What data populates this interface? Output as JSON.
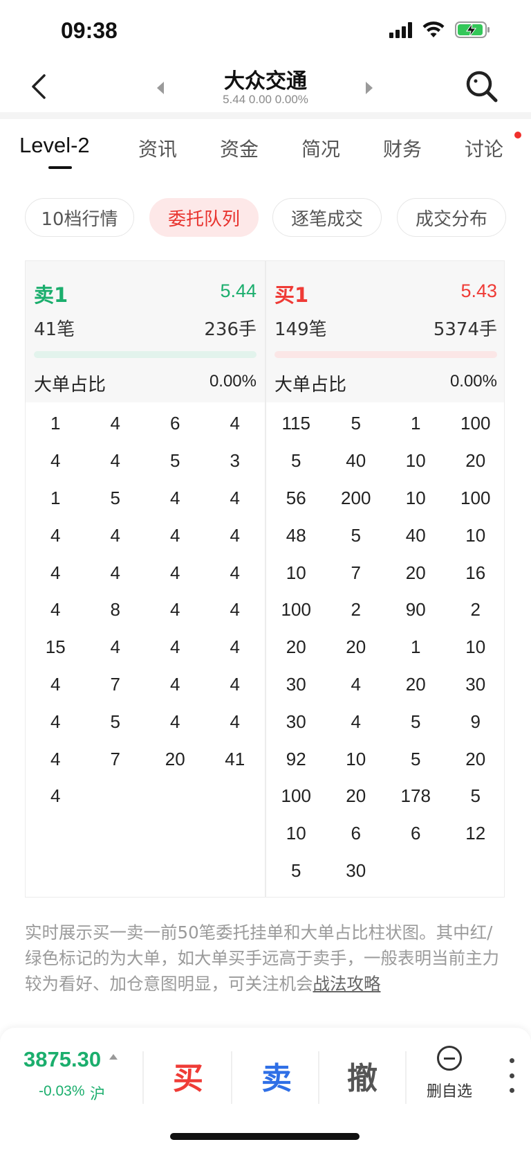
{
  "status_bar": {
    "time": "09:38"
  },
  "header": {
    "stock_name": "大众交通",
    "stock_quote": "5.44 0.00 0.00%"
  },
  "tabs": [
    {
      "label": "Level-2",
      "active": true
    },
    {
      "label": "资讯"
    },
    {
      "label": "资金"
    },
    {
      "label": "简况"
    },
    {
      "label": "财务"
    },
    {
      "label": "讨论"
    }
  ],
  "subtabs": [
    {
      "label": "10档行情"
    },
    {
      "label": "委托队列",
      "active": true
    },
    {
      "label": "逐笔成交"
    },
    {
      "label": "成交分布"
    }
  ],
  "sell": {
    "label": "卖1",
    "price": "5.44",
    "orders": "41笔",
    "hands": "236手",
    "big_label": "大单占比",
    "big_value": "0.00%",
    "queue": [
      [
        "1",
        "4",
        "6",
        "4"
      ],
      [
        "4",
        "4",
        "5",
        "3"
      ],
      [
        "1",
        "5",
        "4",
        "4"
      ],
      [
        "4",
        "4",
        "4",
        "4"
      ],
      [
        "4",
        "4",
        "4",
        "4"
      ],
      [
        "4",
        "8",
        "4",
        "4"
      ],
      [
        "15",
        "4",
        "4",
        "4"
      ],
      [
        "4",
        "7",
        "4",
        "4"
      ],
      [
        "4",
        "5",
        "4",
        "4"
      ],
      [
        "4",
        "7",
        "20",
        "41"
      ],
      [
        "4"
      ]
    ]
  },
  "buy": {
    "label": "买1",
    "price": "5.43",
    "orders": "149笔",
    "hands": "5374手",
    "big_label": "大单占比",
    "big_value": "0.00%",
    "queue": [
      [
        "115",
        "5",
        "1",
        "100"
      ],
      [
        "5",
        "40",
        "10",
        "20"
      ],
      [
        "56",
        "200",
        "10",
        "100"
      ],
      [
        "48",
        "5",
        "40",
        "10"
      ],
      [
        "10",
        "7",
        "20",
        "16"
      ],
      [
        "100",
        "2",
        "90",
        "2"
      ],
      [
        "20",
        "20",
        "1",
        "10"
      ],
      [
        "30",
        "4",
        "20",
        "30"
      ],
      [
        "30",
        "4",
        "5",
        "9"
      ],
      [
        "92",
        "10",
        "5",
        "20"
      ],
      [
        "100",
        "20",
        "178",
        "5"
      ],
      [
        "10",
        "6",
        "6",
        "12"
      ],
      [
        "5",
        "30"
      ]
    ]
  },
  "description": {
    "text": "实时展示买一卖一前50笔委托挂单和大单占比柱状图。其中红/绿色标记的为大单，如大单买手远高于卖手，一般表明当前主力较为看好、加仓意图明显，可关注机会",
    "link": "战法攻略"
  },
  "bottom_bar": {
    "index_value": "3875.30",
    "index_change": "-0.03%",
    "index_market": "沪",
    "buy_label": "买",
    "sell_label": "卖",
    "cancel_label": "撤",
    "fav_label": "删自选"
  },
  "colors": {
    "up": "#ef3b36",
    "down": "#1bae6d",
    "sell_btn": "#2f6fe6"
  }
}
